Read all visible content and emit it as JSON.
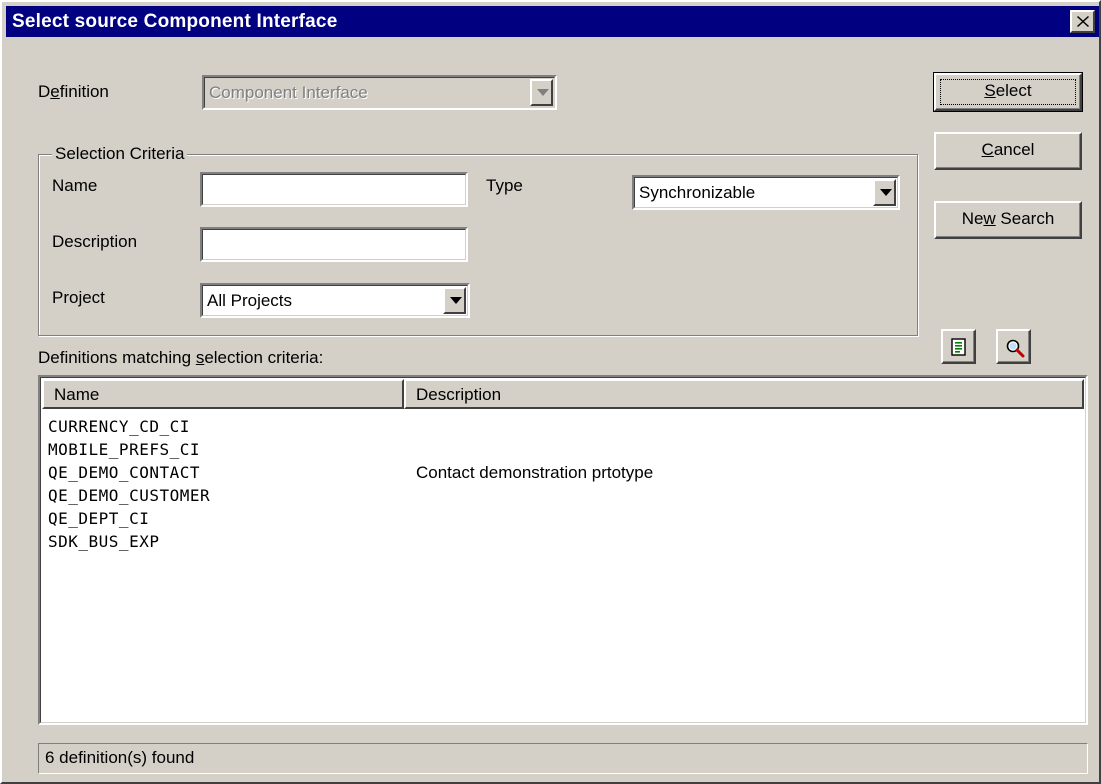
{
  "window": {
    "title": "Select source Component Interface"
  },
  "definition": {
    "label_pre": "D",
    "label_key": "e",
    "label_post": "finition",
    "value": "Component Interface"
  },
  "selection_criteria": {
    "legend": "Selection Criteria",
    "name_label": "Name",
    "name_value": "",
    "description_label": "Description",
    "description_value": "",
    "project_label": "Project",
    "project_value": "All Projects",
    "type_label": "Type",
    "type_value": "Synchronizable"
  },
  "buttons": {
    "select_key": "S",
    "select_rest": "elect",
    "cancel_key": "C",
    "cancel_rest": "ancel",
    "new_search_pre": "Ne",
    "new_search_key": "w",
    "new_search_post": " Search"
  },
  "toolbar_icons": [
    "properties-icon",
    "view-definition-icon"
  ],
  "results": {
    "label_pre": "Definitions matching ",
    "label_key": "s",
    "label_post": "election criteria:",
    "columns": [
      "Name",
      "Description"
    ],
    "rows": [
      {
        "name": "CURRENCY_CD_CI",
        "description": ""
      },
      {
        "name": "MOBILE_PREFS_CI",
        "description": ""
      },
      {
        "name": "QE_DEMO_CONTACT",
        "description": "Contact demonstration prtotype"
      },
      {
        "name": "QE_DEMO_CUSTOMER",
        "description": ""
      },
      {
        "name": "QE_DEPT_CI",
        "description": ""
      },
      {
        "name": "SDK_BUS_EXP",
        "description": ""
      }
    ]
  },
  "status": {
    "text": "6 definition(s) found"
  }
}
